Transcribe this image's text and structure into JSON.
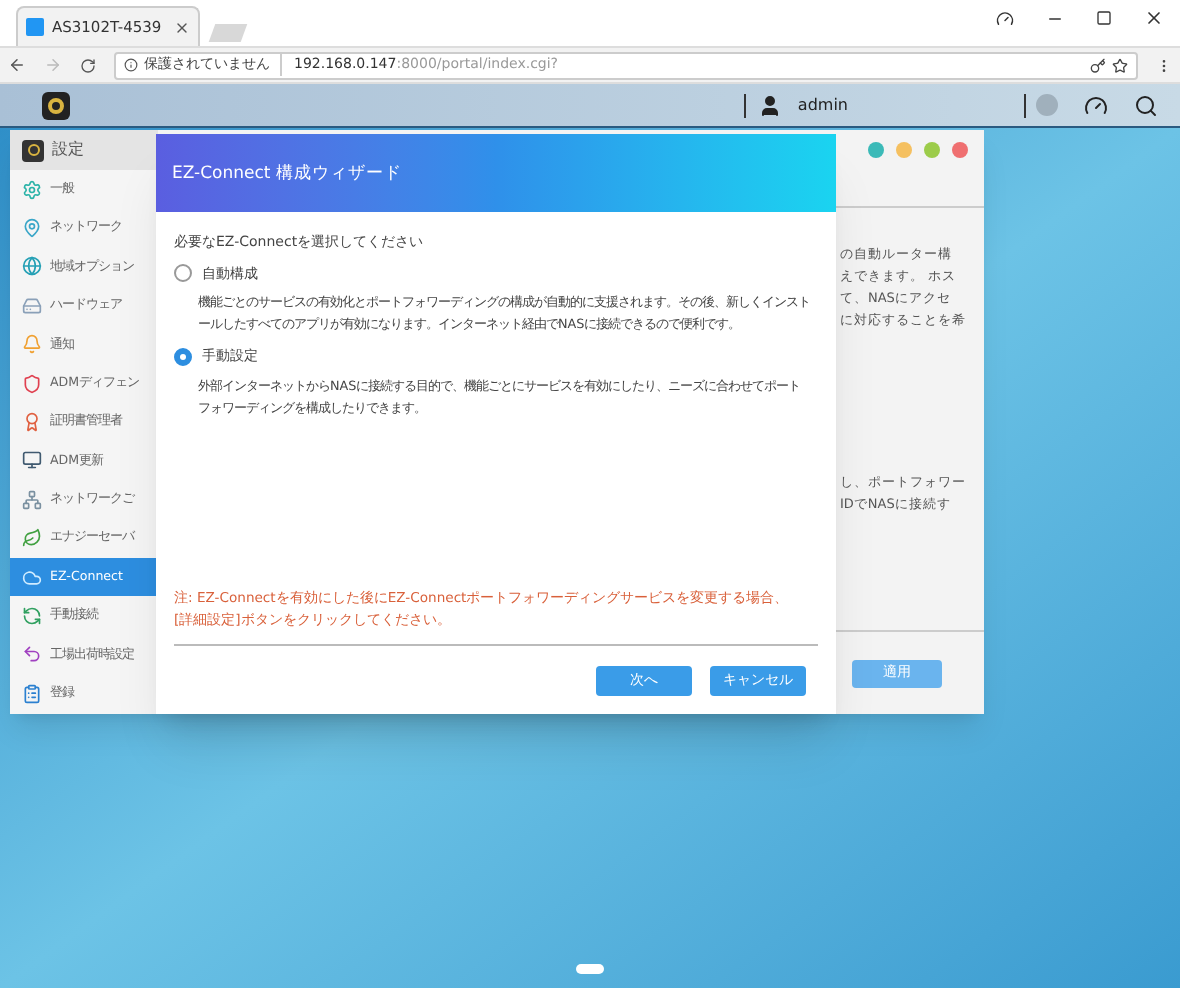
{
  "browser": {
    "tab_title": "AS3102T-4539",
    "security": "保護されていません",
    "url_host": "192.168.0.147",
    "url_rest": ":8000/portal/index.cgi?"
  },
  "top_bar": {
    "user": "admin"
  },
  "settings_window": {
    "title": "設定",
    "sidebar": [
      {
        "label": "一般",
        "selected": false
      },
      {
        "label": "ネットワーク",
        "selected": false
      },
      {
        "label": "地域オプション",
        "selected": false
      },
      {
        "label": "ハードウェア",
        "selected": false
      },
      {
        "label": "通知",
        "selected": false
      },
      {
        "label": "ADMディフェン",
        "selected": false
      },
      {
        "label": "証明書管理者",
        "selected": false
      },
      {
        "label": "ADM更新",
        "selected": false
      },
      {
        "label": "ネットワークご",
        "selected": false
      },
      {
        "label": "エナジーセーバ",
        "selected": false
      },
      {
        "label": "EZ-Connect",
        "selected": true
      },
      {
        "label": "手動接続",
        "selected": false
      },
      {
        "label": "工場出荷時設定",
        "selected": false
      },
      {
        "label": "登録",
        "selected": false
      }
    ],
    "text_upper": [
      "の自動ルーター構",
      "えできます。 ホス",
      "て、NASにアクセ",
      "に対応することを希"
    ],
    "text_lower": [
      "し、ポートフォワー",
      "IDでNASに接続す"
    ],
    "apply_button": "適用"
  },
  "dialog": {
    "title": "EZ-Connect 構成ウィザード",
    "prompt": "必要なEZ-Connectを選択してください",
    "options": [
      {
        "label": "自動構成",
        "selected": false,
        "description": "機能ごとのサービスの有効化とポートフォワーディングの構成が自動的に支援されます。その後、新しくインストールしたすべてのアプリが有効になります。インターネット経由でNASに接続できるので便利です。"
      },
      {
        "label": "手動設定",
        "selected": true,
        "description": "外部インターネットからNASに接続する目的で、機能ごとにサービスを有効にしたり、ニーズに合わせてポートフォワーディングを構成したりできます。"
      }
    ],
    "note": "注: EZ-Connectを有効にした後にEZ-Connectポートフォワーディングサービスを変更する場合、[詳細設定]ボタンをクリックしてください。",
    "buttons": [
      "次へ",
      "キャンセル"
    ]
  }
}
